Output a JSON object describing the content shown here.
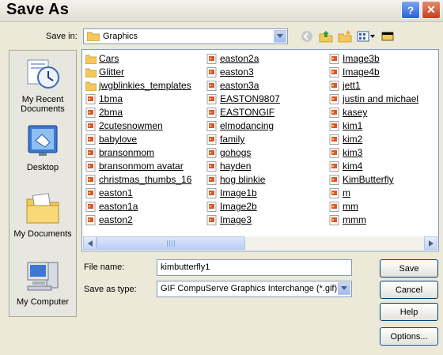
{
  "window": {
    "title": "Save As"
  },
  "save_in": {
    "label": "Save in:",
    "value": "Graphics"
  },
  "places": [
    {
      "label": "My Recent Documents",
      "icon": "recent-documents-icon"
    },
    {
      "label": "Desktop",
      "icon": "desktop-icon"
    },
    {
      "label": "My Documents",
      "icon": "my-documents-icon"
    },
    {
      "label": "My Computer",
      "icon": "my-computer-icon"
    }
  ],
  "files": {
    "col1": [
      "Cars",
      "Glitter",
      "jwgblinkies_templates",
      "1bma",
      "2bma",
      "2cutesnowmen",
      "babylove",
      "bransonmom",
      "bransonmom avatar",
      "christmas_thumbs_16",
      "easton1",
      "easton1a",
      "easton2"
    ],
    "col1_types": [
      "folder",
      "folder",
      "folder",
      "image",
      "image",
      "image",
      "image",
      "image",
      "image",
      "image",
      "image",
      "image",
      "image"
    ],
    "col2": [
      "easton2a",
      "easton3",
      "easton3a",
      "EASTON9807",
      "EASTONGIF",
      "elmodancing",
      "family",
      "gohogs",
      "hayden",
      "hog blinkie",
      "Image1b",
      "Image2b",
      "Image3"
    ],
    "col3": [
      "Image3b",
      "Image4b",
      "jett1",
      "justin and michael",
      "kasey",
      "kim1",
      "kim2",
      "kim3",
      "kim4",
      "KimButterfly",
      "m",
      "mm",
      "mmm"
    ]
  },
  "form": {
    "file_name_label": "File name:",
    "file_name_value": "kimbutterfly1",
    "save_type_label": "Save as type:",
    "save_type_value": "GIF CompuServe Graphics Interchange (*.gif)"
  },
  "buttons": {
    "save": "Save",
    "cancel": "Cancel",
    "help": "Help",
    "options": "Options..."
  },
  "colors": {
    "folder": "#f4c95a",
    "image_icon": "#d9582f",
    "accent": "#316ac5"
  }
}
